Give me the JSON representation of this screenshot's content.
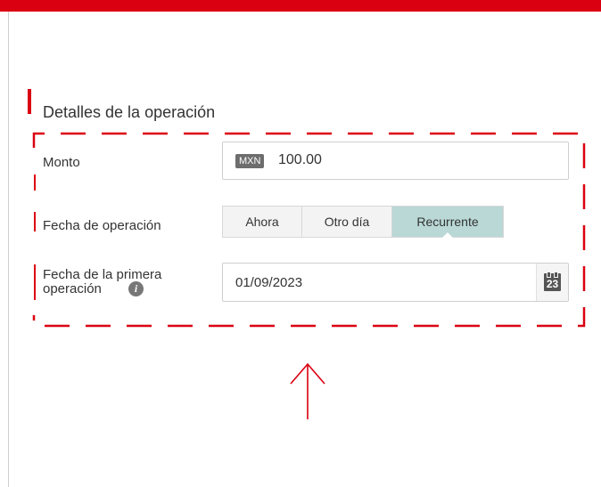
{
  "colors": {
    "brand_red": "#db0011",
    "active_segment": "#b9d8d6",
    "segment_bg": "#f3f3f3"
  },
  "section": {
    "title": "Detalles de la operación"
  },
  "monto": {
    "label": "Monto",
    "currency": "MXN",
    "value": "100.00"
  },
  "fecha_operacion": {
    "label": "Fecha de operación",
    "options": [
      "Ahora",
      "Otro día",
      "Recurrente"
    ],
    "selected": "Recurrente"
  },
  "primera_operacion": {
    "label_line1": "Fecha de la primera",
    "label_line2": "operación",
    "date_value": "01/09/2023",
    "calendar_day": "23",
    "info_glyph": "i"
  },
  "icons": {
    "info": "info-icon",
    "calendar": "calendar-icon",
    "arrow": "arrow-up-icon"
  }
}
